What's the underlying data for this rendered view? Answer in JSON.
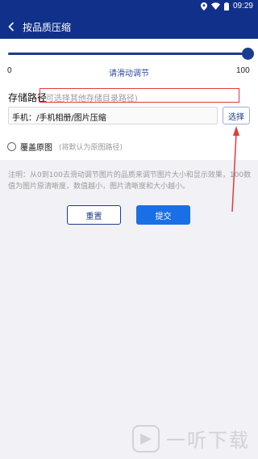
{
  "statusbar": {
    "time": "09:29"
  },
  "appbar": {
    "title": "按品质压缩"
  },
  "slider": {
    "min": "0",
    "max": "100",
    "hint": "请滑动调节",
    "value_fraction": 1.0
  },
  "storage": {
    "label": "存储路径",
    "hint": "(可选择其他存储目录路径)",
    "path_value": "手机：/手机相册/图片压缩",
    "select_label": "选择"
  },
  "overwrite": {
    "label": "覆盖原图",
    "hint": "(将默认为原图路径)"
  },
  "note": "注明：从0到100去滑动调节图片的品质来调节图片大小和显示效果，100数值为图片原清晰度，数值越小，图片清晰度和大小越小。",
  "buttons": {
    "reset": "重置",
    "submit": "提交"
  },
  "watermark": {
    "text": "一听下载"
  },
  "colors": {
    "primary": "#10308a",
    "accent": "#1a6fe6",
    "annotation": "#e23a3a"
  }
}
